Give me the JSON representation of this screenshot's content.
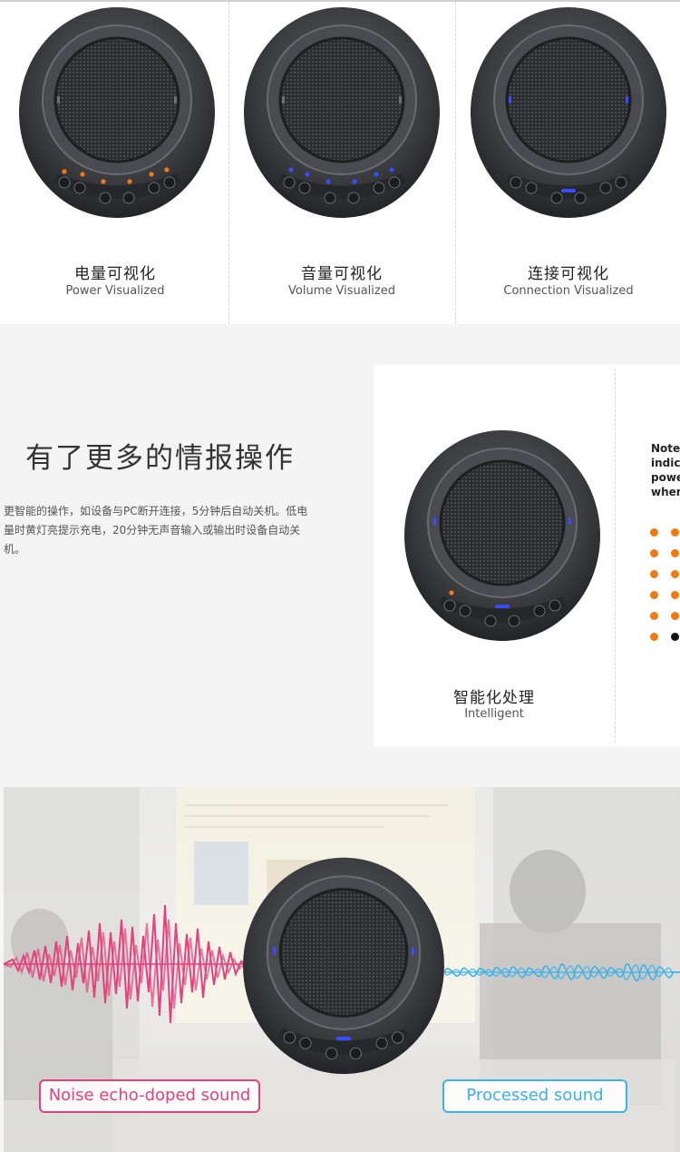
{
  "features": [
    {
      "title_cn": "电量可视化",
      "title_en": "Power Visualized"
    },
    {
      "title_cn": "音量可视化",
      "title_en": "Volume Visualized"
    },
    {
      "title_cn": "连接可视化",
      "title_en": "Connection Visualized"
    }
  ],
  "section2": {
    "heading": "有了更多的情报操作",
    "description": "更智能的操作，如设备与PC断开连接，5分钟后自动关机。低电量时黄灯亮提示充电，20分钟无声音输入或输出时设备自动关机。",
    "card": {
      "title_cn": "智能化处理",
      "title_en": "Intelligent"
    },
    "note_text": "Note\nindic\npowe\nwhen"
  },
  "section3": {
    "noise_label": "Noise echo-doped sound",
    "processed_label": "Processed sound"
  },
  "colors": {
    "orange_led": "#f07a10",
    "blue_led": "#3a4cff",
    "noise_wave": "#e4417d",
    "processed_wave": "#3db2ea"
  }
}
